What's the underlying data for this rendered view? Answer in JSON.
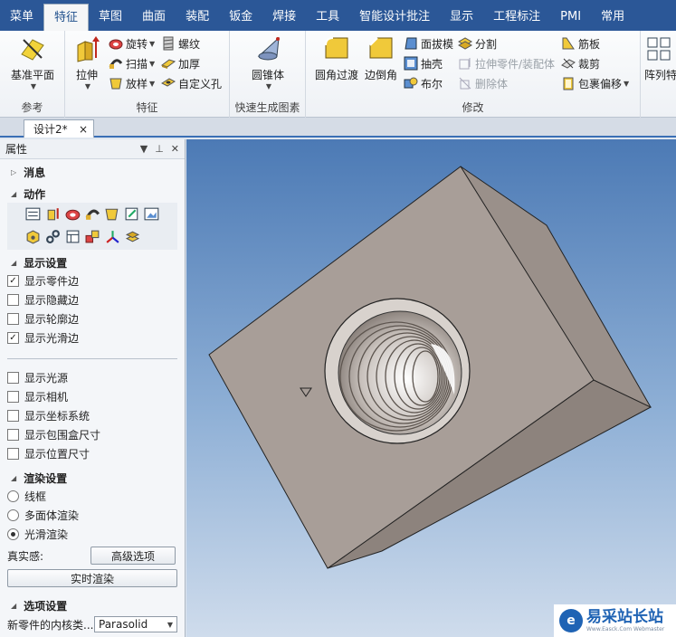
{
  "menu": {
    "tabs": [
      "菜单",
      "特征",
      "草图",
      "曲面",
      "装配",
      "钣金",
      "焊接",
      "工具",
      "智能设计批注",
      "显示",
      "工程标注",
      "PMI",
      "常用"
    ],
    "active_index": 1
  },
  "ribbon": {
    "groups": {
      "reference": "参考",
      "feature": "特征",
      "quick": "快速生成图素",
      "modify": "修改"
    },
    "buttons": {
      "datum_plane": "基准平面",
      "extrude": "拉伸",
      "revolve": "旋转",
      "sweep": "扫描",
      "loft": "放样",
      "thread": "螺纹",
      "thicken": "加厚",
      "custom_hole": "自定义孔",
      "cone": "圆锥体",
      "fillet": "圆角过渡",
      "chamfer": "边倒角",
      "draft": "面拔模",
      "shell": "抽壳",
      "boolean": "布尔",
      "split": "分割",
      "extrude_part": "拉伸零件/装配体",
      "delete_body": "删除体",
      "rib": "筋板",
      "trim": "裁剪",
      "wrap_offset": "包裹偏移",
      "pattern": "阵列特"
    }
  },
  "document": {
    "tab_label": "设计2*",
    "close": "×"
  },
  "panel": {
    "title": "属性",
    "sections": {
      "messages": "消息",
      "actions": "动作",
      "display": "显示设置",
      "render": "渲染设置",
      "options": "选项设置"
    },
    "display_checks": [
      {
        "label": "显示零件边",
        "checked": true
      },
      {
        "label": "显示隐藏边",
        "checked": false
      },
      {
        "label": "显示轮廓边",
        "checked": false
      },
      {
        "label": "显示光滑边",
        "checked": true
      }
    ],
    "extra_checks": [
      {
        "label": "显示光源",
        "checked": false
      },
      {
        "label": "显示相机",
        "checked": false
      },
      {
        "label": "显示坐标系统",
        "checked": false
      },
      {
        "label": "显示包围盒尺寸",
        "checked": false
      },
      {
        "label": "显示位置尺寸",
        "checked": false
      }
    ],
    "render_modes": [
      {
        "label": "线框",
        "selected": false
      },
      {
        "label": "多面体渲染",
        "selected": false
      },
      {
        "label": "光滑渲染",
        "selected": true
      }
    ],
    "realism_label": "真实感:",
    "advanced_button": "高级选项",
    "realtime_button": "实时渲染",
    "kernel_label": "新零件的内核类...",
    "kernel_value": "Parasolid"
  },
  "watermark": {
    "brand": "易采站长站",
    "sub": "Www.Easck.Com  Webmaster"
  },
  "colors": {
    "menubar": "#2b5797",
    "accent": "#3a6fb5",
    "part": "#a89e98"
  }
}
